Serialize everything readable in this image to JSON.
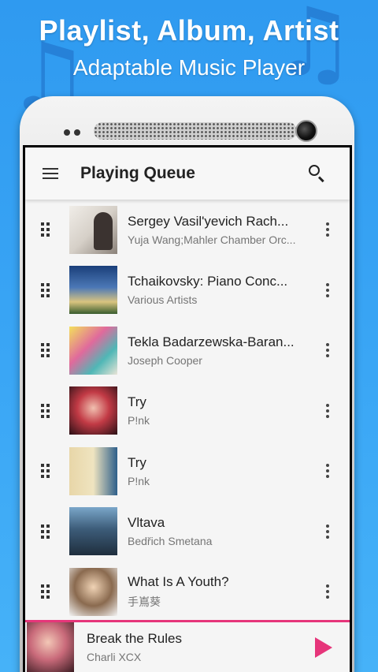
{
  "promo": {
    "title": "Playlist, Album, Artist",
    "subtitle": "Adaptable Music Player"
  },
  "toolbar": {
    "menu_icon": "hamburger-menu-icon",
    "title": "Playing Queue",
    "search_icon": "search-icon"
  },
  "queue": [
    {
      "title": "Sergey Vasil'yevich Rach...",
      "artist": "Yuja Wang;Mahler Chamber Orc..."
    },
    {
      "title": "Tchaikovsky: Piano Conc...",
      "artist": "Various Artists"
    },
    {
      "title": "Tekla Badarzewska-Baran...",
      "artist": "Joseph Cooper"
    },
    {
      "title": "Try",
      "artist": "P!nk"
    },
    {
      "title": "Try",
      "artist": "P!nk"
    },
    {
      "title": "Vltava",
      "artist": "Bedřich Smetana"
    },
    {
      "title": "What Is A Youth?",
      "artist": "手嶌葵"
    }
  ],
  "now_playing": {
    "title": "Break the Rules",
    "artist": "Charli XCX",
    "play_icon": "play-icon"
  },
  "colors": {
    "accent": "#e6357a",
    "background": "#3aa6f5"
  }
}
